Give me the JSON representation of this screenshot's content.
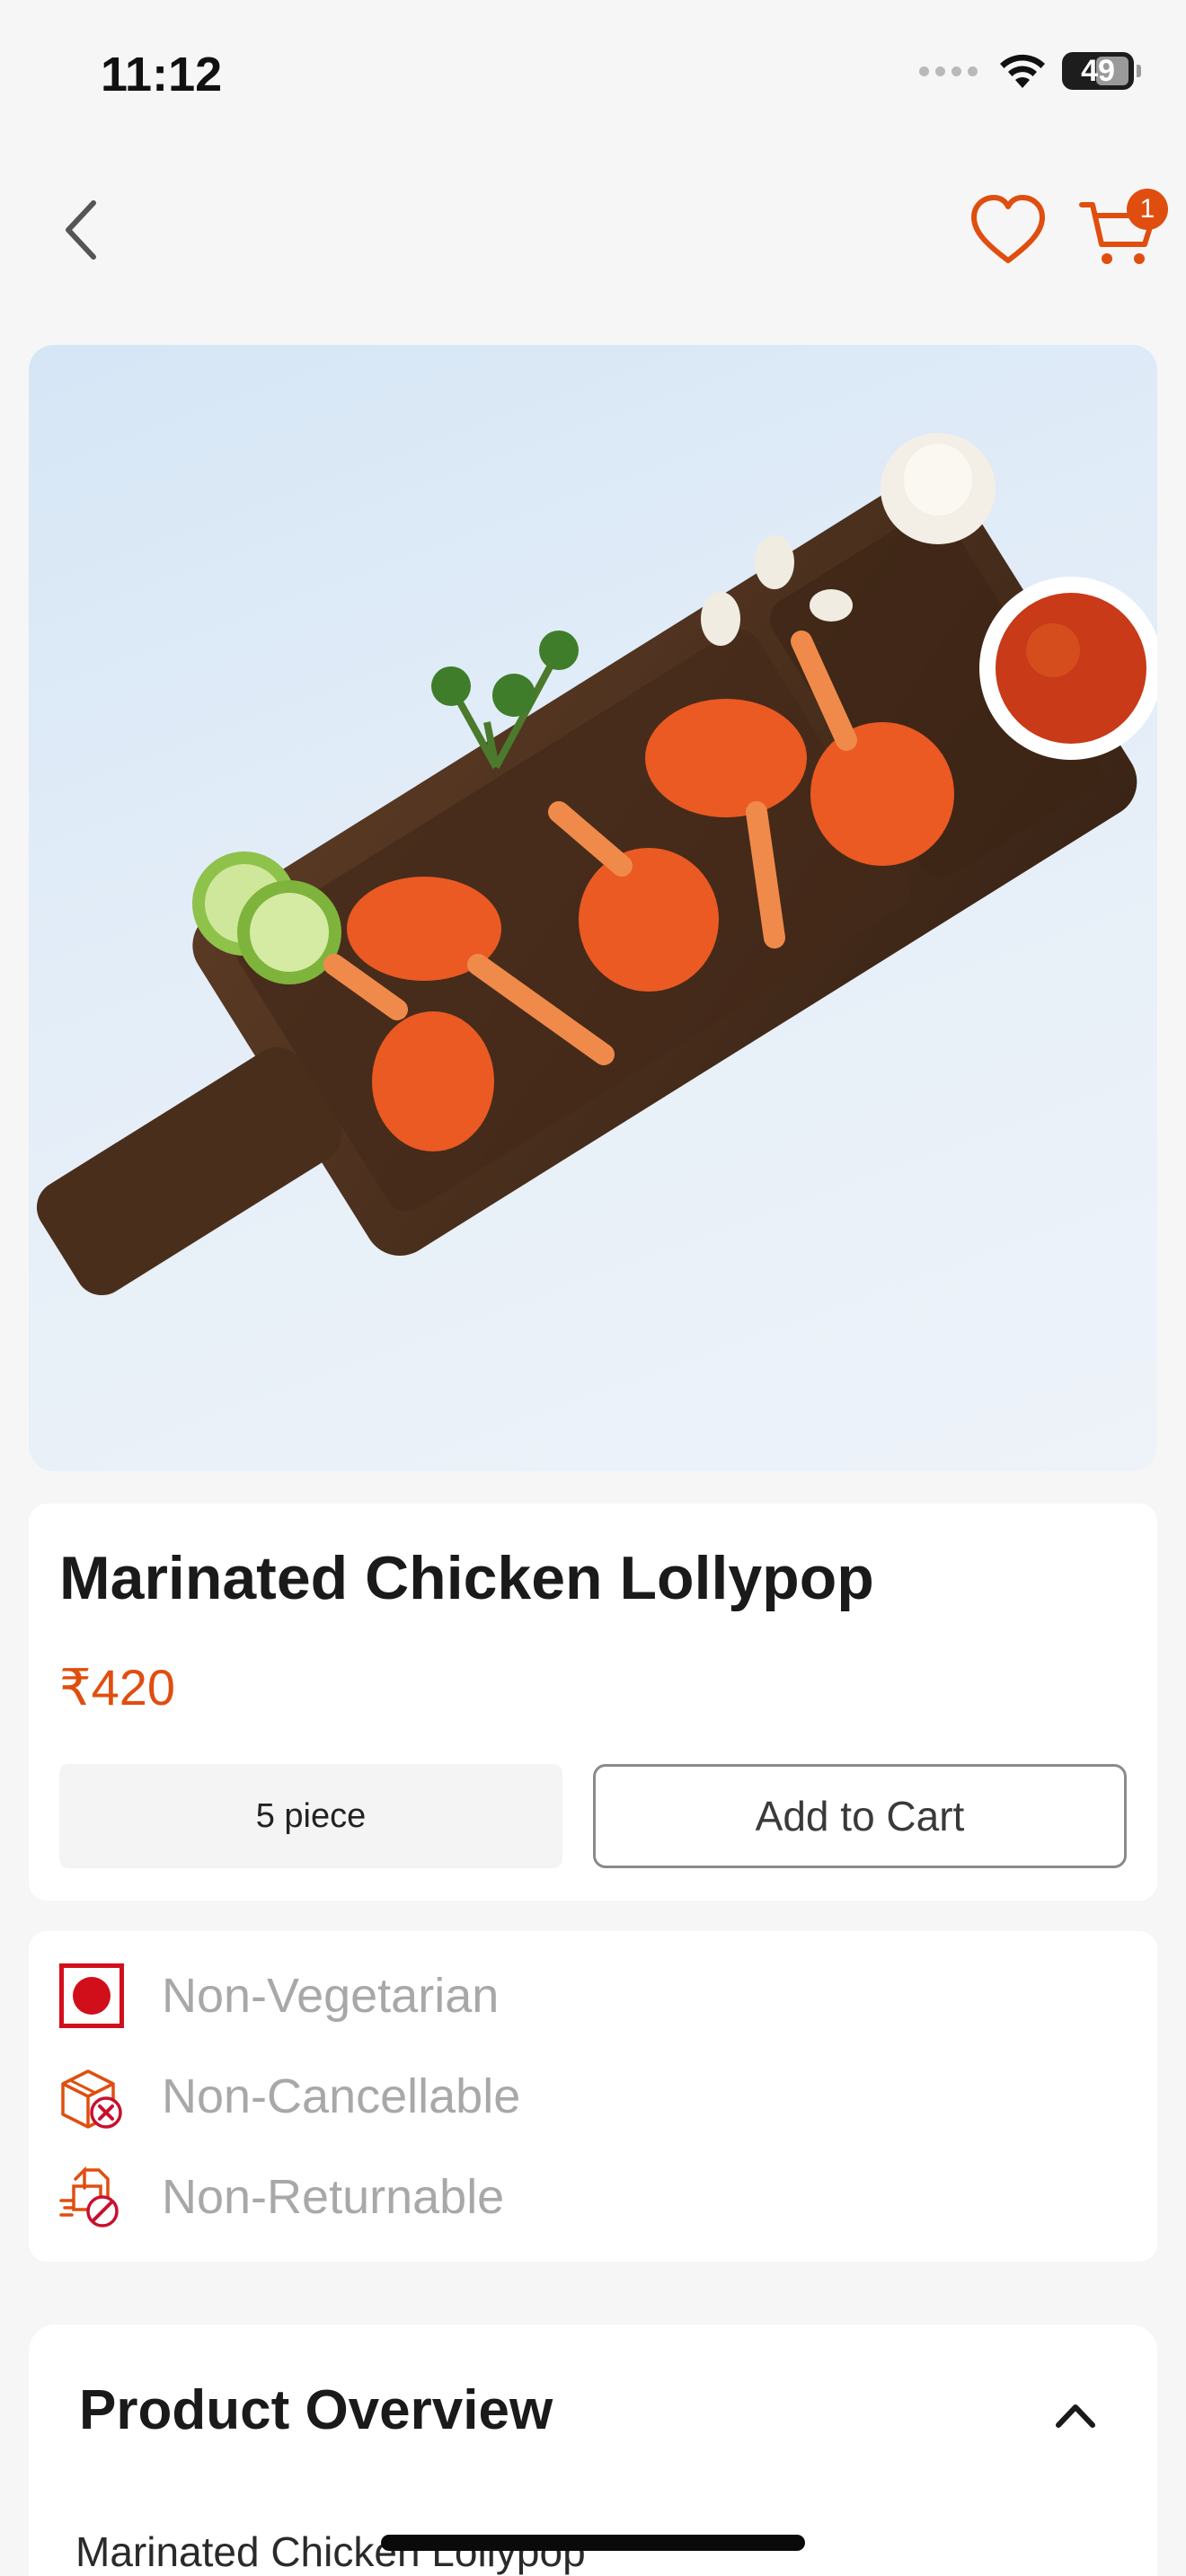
{
  "status_bar": {
    "time": "11:12",
    "battery": "49"
  },
  "nav": {
    "back_icon": "chevron-left-icon",
    "wishlist_icon": "heart-outline-icon",
    "cart_icon": "cart-icon",
    "cart_count": "1"
  },
  "product": {
    "name": "Marinated Chicken Lollypop",
    "price": "₹420",
    "variant": "5 piece",
    "add_to_cart_label": "Add to Cart"
  },
  "attributes": [
    {
      "label": "Non-Vegetarian",
      "icon": "non-veg-icon"
    },
    {
      "label": "Non-Cancellable",
      "icon": "non-cancellable-icon"
    },
    {
      "label": "Non-Returnable",
      "icon": "non-returnable-icon"
    }
  ],
  "overview": {
    "title": "Product Overview",
    "toggle_icon": "chevron-up-icon",
    "text": "Marinated Chicken Lollypop"
  },
  "colors": {
    "accent": "#e04e0f",
    "non_veg_red": "#d10f1a",
    "background": "#f6f6f6",
    "muted_text": "#a8a8a8"
  }
}
